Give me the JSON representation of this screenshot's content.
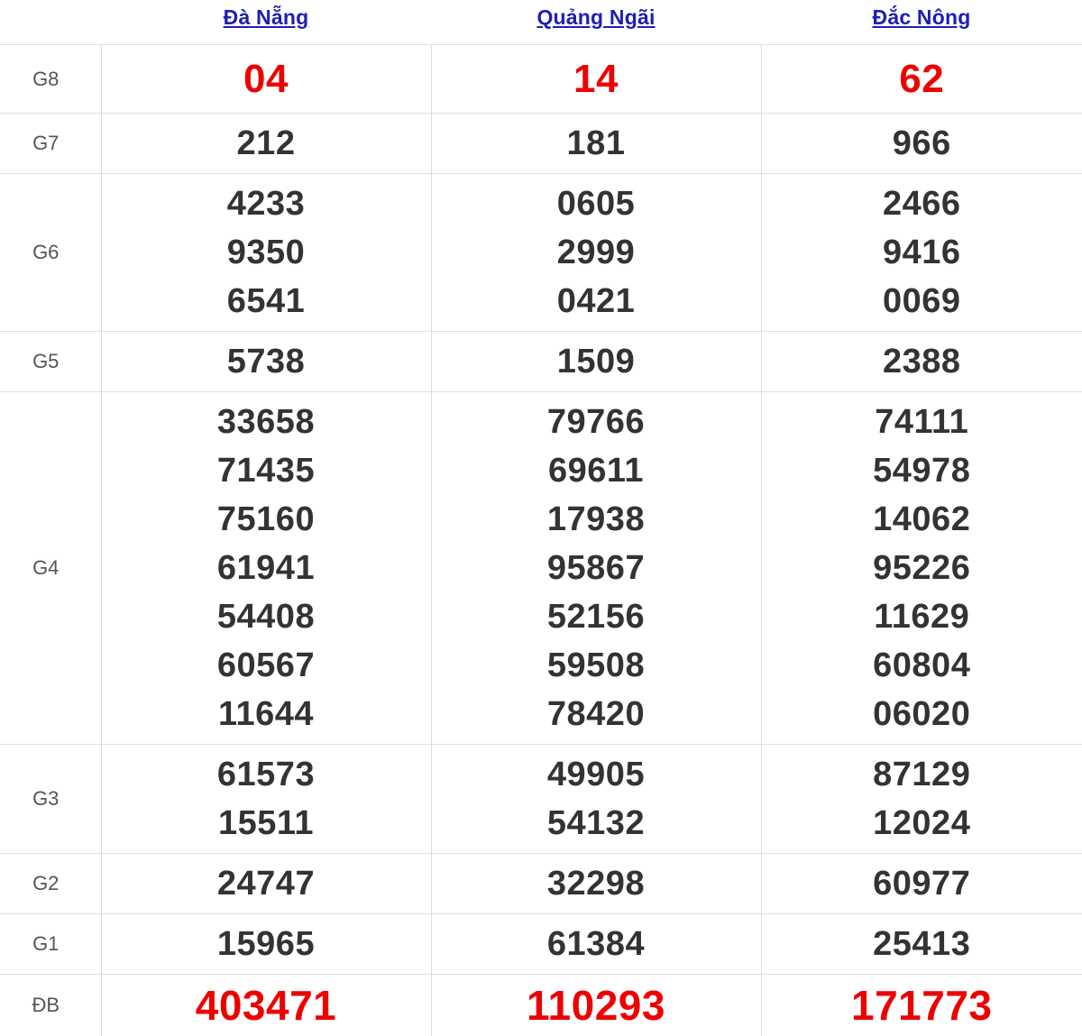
{
  "provinces": [
    "Đà Nẵng",
    "Quảng Ngãi",
    "Đắc Nông"
  ],
  "prize_labels": {
    "g8": "G8",
    "g7": "G7",
    "g6": "G6",
    "g5": "G5",
    "g4": "G4",
    "g3": "G3",
    "g2": "G2",
    "g1": "G1",
    "db": "ĐB"
  },
  "results": {
    "g8": [
      [
        "04"
      ],
      [
        "14"
      ],
      [
        "62"
      ]
    ],
    "g7": [
      [
        "212"
      ],
      [
        "181"
      ],
      [
        "966"
      ]
    ],
    "g6": [
      [
        "4233",
        "9350",
        "6541"
      ],
      [
        "0605",
        "2999",
        "0421"
      ],
      [
        "2466",
        "9416",
        "0069"
      ]
    ],
    "g5": [
      [
        "5738"
      ],
      [
        "1509"
      ],
      [
        "2388"
      ]
    ],
    "g4": [
      [
        "33658",
        "71435",
        "75160",
        "61941",
        "54408",
        "60567",
        "11644"
      ],
      [
        "79766",
        "69611",
        "17938",
        "95867",
        "52156",
        "59508",
        "78420"
      ],
      [
        "74111",
        "54978",
        "14062",
        "95226",
        "11629",
        "60804",
        "06020"
      ]
    ],
    "g3": [
      [
        "61573",
        "15511"
      ],
      [
        "49905",
        "54132"
      ],
      [
        "87129",
        "12024"
      ]
    ],
    "g2": [
      [
        "24747"
      ],
      [
        "32298"
      ],
      [
        "60977"
      ]
    ],
    "g1": [
      [
        "15965"
      ],
      [
        "61384"
      ],
      [
        "25413"
      ]
    ],
    "db": [
      [
        "403471"
      ],
      [
        "110293"
      ],
      [
        "171773"
      ]
    ]
  },
  "colors": {
    "link": "#1f1fb4",
    "highlight": "#ee0000",
    "number": "#333333",
    "label": "#555555",
    "border": "#dddddd"
  }
}
